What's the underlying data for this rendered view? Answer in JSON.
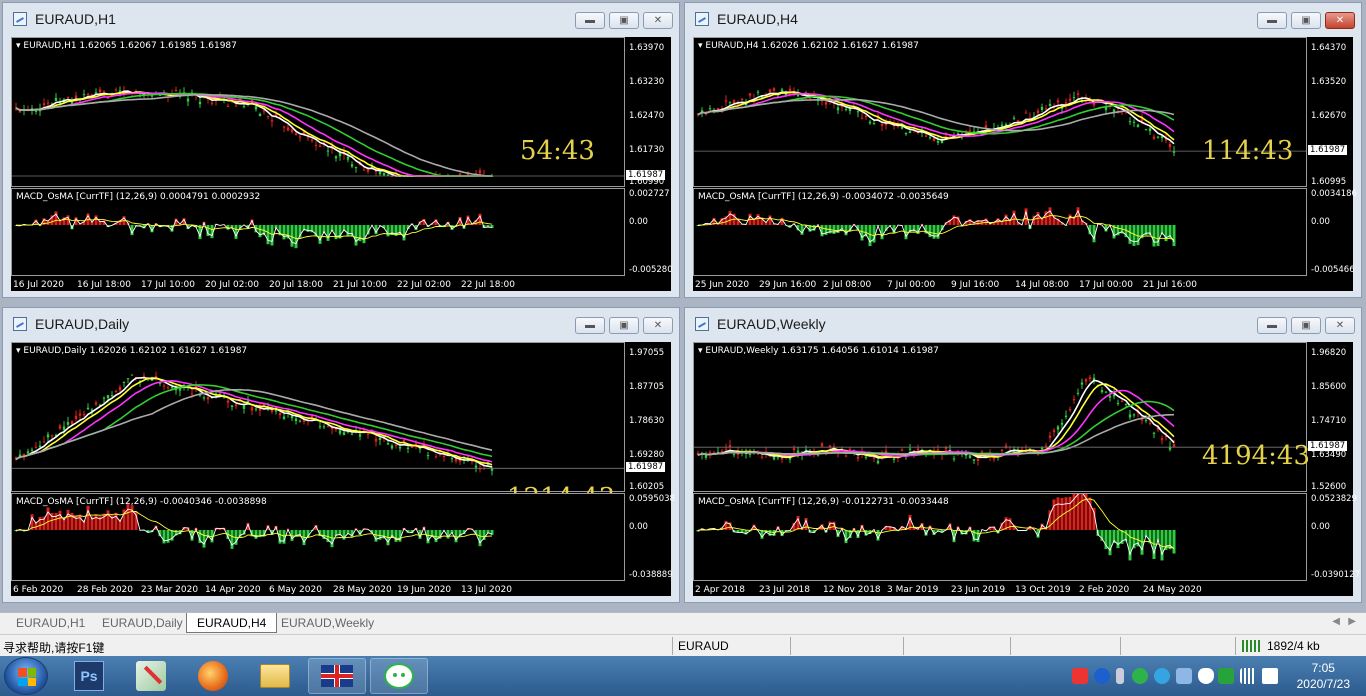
{
  "windows": [
    {
      "id": "h1",
      "title": "EURAUD,H1",
      "ohlc": "EURAUD,H1  1.62065 1.62067 1.61985 1.61987",
      "macd": "MACD_OsMA [CurrTF] (12,26,9) 0.0004791 0.0002932",
      "timer": "54:43",
      "price_labels": [
        "1.63970",
        "1.63230",
        "1.62470",
        "1.61730",
        "1.60990"
      ],
      "current_price": "1.61987",
      "macd_labels": [
        "0.002727",
        "0.00",
        "-0.005280"
      ],
      "dates": [
        "16 Jul 2020",
        "16 Jul 18:00",
        "17 Jul 10:00",
        "20 Jul 02:00",
        "20 Jul 18:00",
        "21 Jul 10:00",
        "22 Jul 02:00",
        "22 Jul 18:00"
      ]
    },
    {
      "id": "h4",
      "title": "EURAUD,H4",
      "ohlc": "EURAUD,H4  1.62026 1.62102 1.61627 1.61987",
      "macd": "MACD_OsMA [CurrTF] (12,26,9) -0.0034072 -0.0035649",
      "timer": "114:43",
      "price_labels": [
        "1.64370",
        "1.63520",
        "1.62670",
        "1.61820",
        "1.60995"
      ],
      "current_price": "1.61987",
      "macd_labels": [
        "0.0034186",
        "0.00",
        "-0.005466"
      ],
      "dates": [
        "25 Jun 2020",
        "29 Jun 16:00",
        "2 Jul 08:00",
        "7 Jul 00:00",
        "9 Jul 16:00",
        "14 Jul 08:00",
        "17 Jul 00:00",
        "21 Jul 16:00"
      ]
    },
    {
      "id": "daily",
      "title": "EURAUD,Daily",
      "ohlc": "EURAUD,Daily  1.62026 1.62102 1.61627 1.61987",
      "macd": "MACD_OsMA [CurrTF] (12,26,9) -0.0040346 -0.0038898",
      "timer": "1214:43",
      "price_labels": [
        "1.97055",
        "1.87705",
        "1.78630",
        "1.69280",
        "1.60205"
      ],
      "current_price": "1.61987",
      "macd_labels": [
        "0.0595038",
        "0.00",
        "-0.038889"
      ],
      "dates": [
        "6 Feb 2020",
        "28 Feb 2020",
        "23 Mar 2020",
        "14 Apr 2020",
        "6 May 2020",
        "28 May 2020",
        "19 Jun 2020",
        "13 Jul 2020"
      ]
    },
    {
      "id": "weekly",
      "title": "EURAUD,Weekly",
      "ohlc": "EURAUD,Weekly  1.63175 1.64056 1.61014 1.61987",
      "macd": "MACD_OsMA [CurrTF] (12,26,9) -0.0122731 -0.0033448",
      "timer": "4194:43",
      "price_labels": [
        "1.96820",
        "1.85600",
        "1.74710",
        "1.63490",
        "1.52600"
      ],
      "current_price": "1.61987",
      "macd_labels": [
        "0.0523829",
        "0.00",
        "-0.0390127"
      ],
      "dates": [
        "2 Apr 2018",
        "23 Jul 2018",
        "12 Nov 2018",
        "3 Mar 2019",
        "23 Jun 2019",
        "13 Oct 2019",
        "2 Feb 2020",
        "24 May 2020"
      ]
    }
  ],
  "tabs": [
    "EURAUD,H1",
    "EURAUD,Daily",
    "EURAUD,H4",
    "EURAUD,Weekly"
  ],
  "active_tab": "EURAUD,H4",
  "status": {
    "help": "寻求帮助,请按F1键",
    "symbol": "EURAUD",
    "traffic": "1892/4 kb"
  },
  "clock": {
    "time": "7:05",
    "date": "2020/7/23"
  },
  "taskbar_items": [
    "start-button",
    "photoshop",
    "paint-tool",
    "firefox",
    "explorer",
    "uk-flag-app",
    "wechat"
  ],
  "colors": {
    "bull": "#2ecc40",
    "bear": "#e0201b",
    "ma_white": "#ffffff",
    "ma_yellow": "#ffff33",
    "ma_magenta": "#ff33ff",
    "ma_green": "#33cc33",
    "ma_gray": "#aaaaaa",
    "timer": "#e6d24a"
  }
}
